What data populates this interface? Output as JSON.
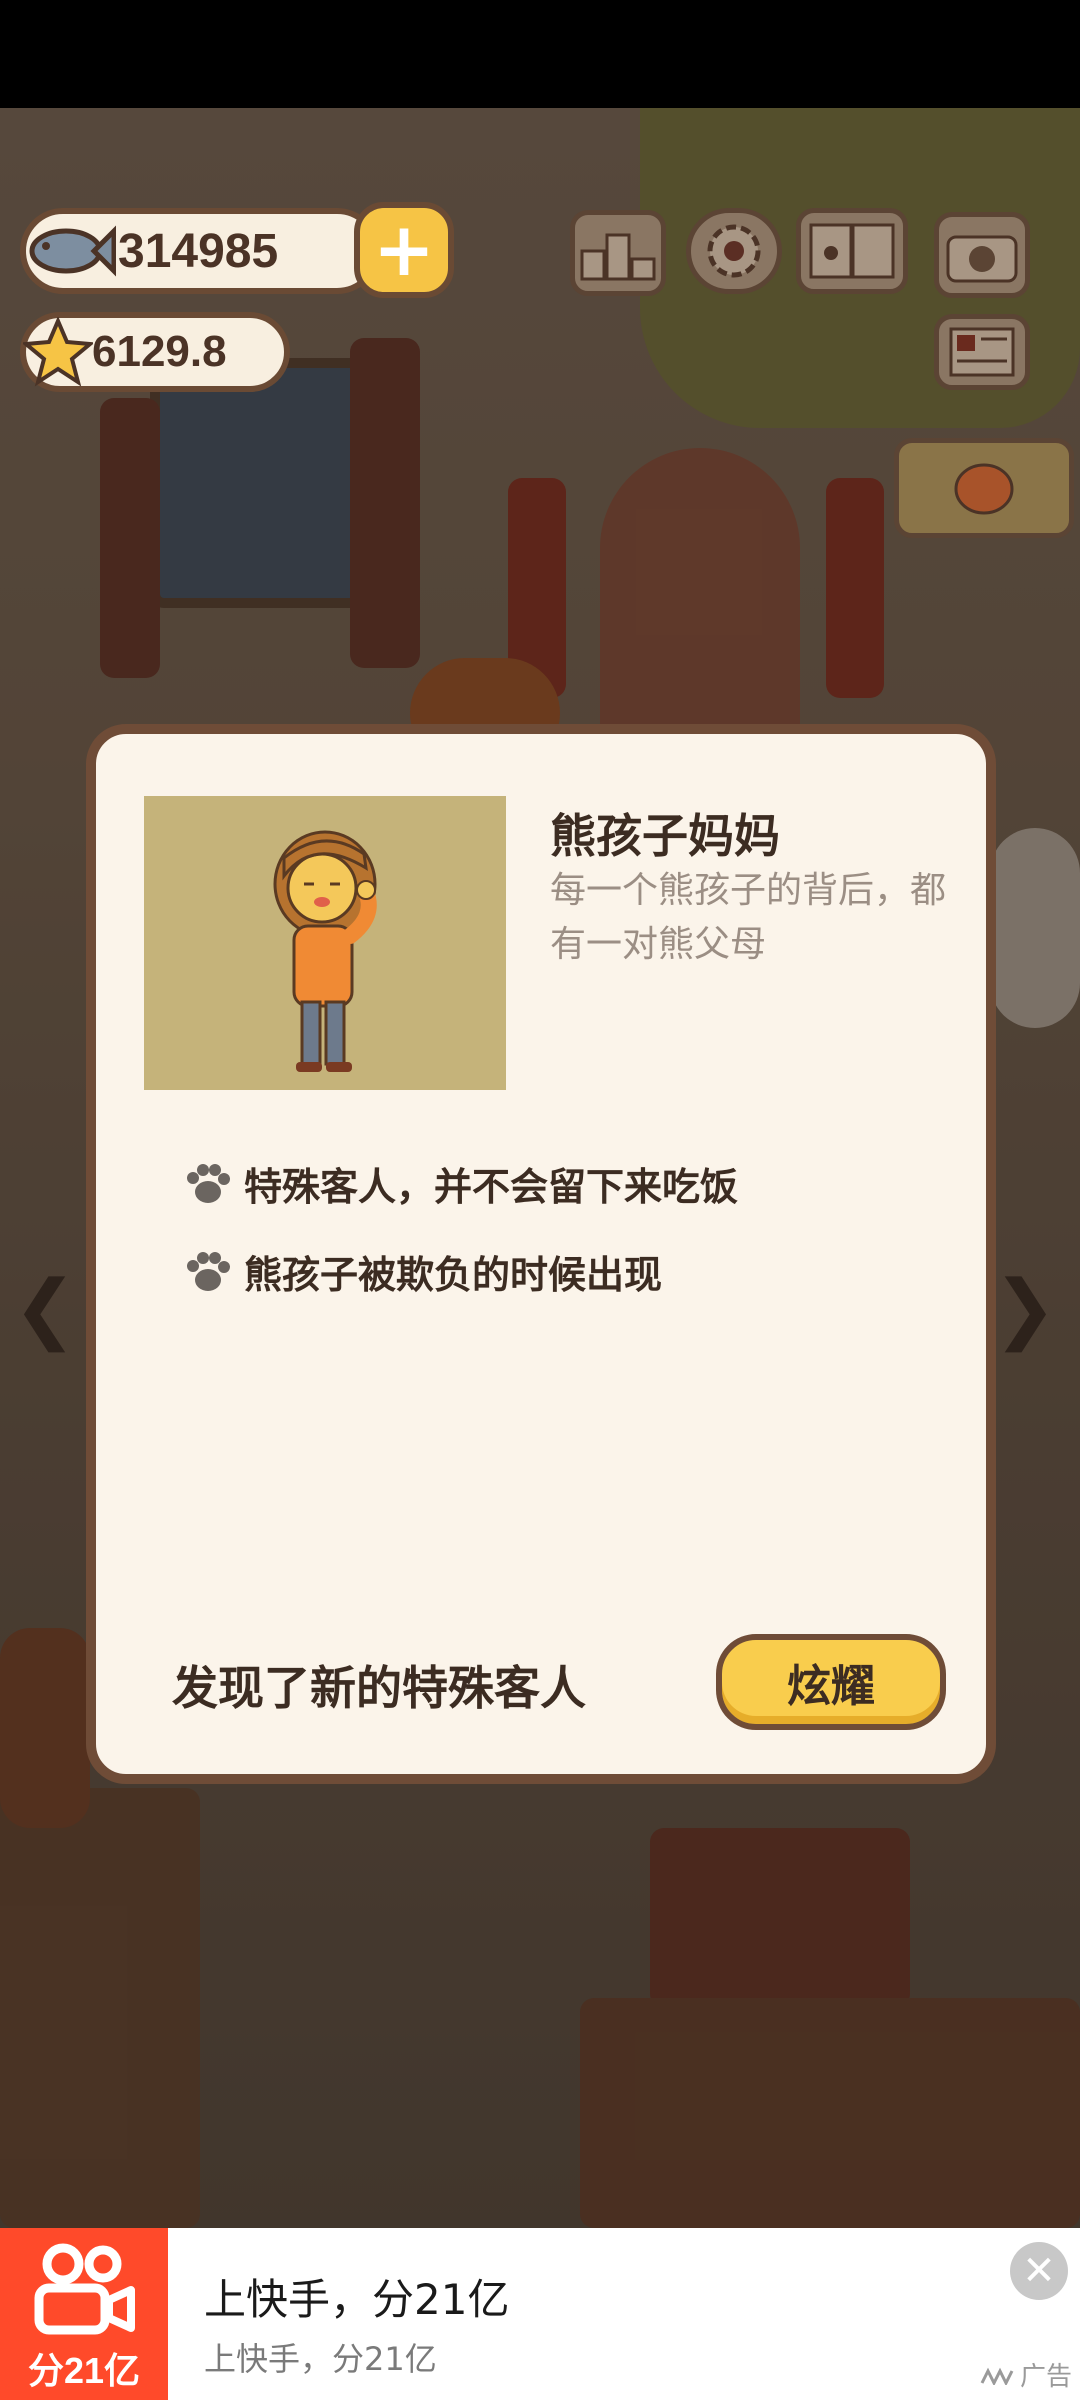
{
  "hud": {
    "fish_count": "314985",
    "star_count": "6129.8",
    "plus_label": "+",
    "icons": [
      "leaderboard-icon",
      "settings-icon",
      "paw-book-icon",
      "camera-icon",
      "newspaper-icon",
      "lantern-icon"
    ]
  },
  "dialog": {
    "name": "熊孩子妈妈",
    "description": "每一个熊孩子的背后，都有一对熊父母",
    "traits": [
      "特殊客人，并不会留下来吃饭",
      "熊孩子被欺负的时候出现"
    ],
    "found_text": "发现了新的特殊客人",
    "boast_label": "炫耀"
  },
  "nav": {
    "left_arrow": "❮",
    "right_arrow": "❯"
  },
  "ad": {
    "logo_text": "分21亿",
    "title": "上快手，分21亿",
    "subtitle": "上快手，分21亿",
    "close_symbol": "✕",
    "label": "广告"
  },
  "colors": {
    "dialog_bg": "#fbf4ea",
    "dialog_border": "#6f4c37",
    "boast_button": "#f9cd4d",
    "ad_logo_bg": "#ff4a2a"
  }
}
